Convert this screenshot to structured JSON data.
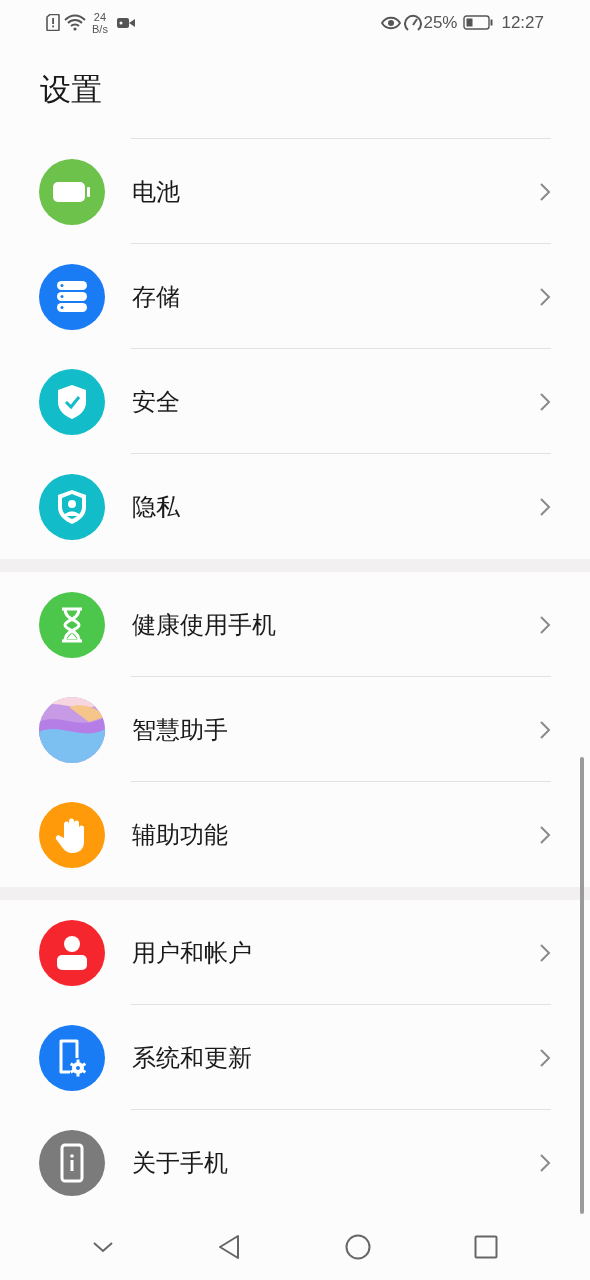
{
  "status_bar": {
    "speed_value": "24",
    "speed_unit": "B/s",
    "battery": "25%",
    "time": "12:27"
  },
  "title": "设置",
  "groups": [
    {
      "items": [
        {
          "label": "电池",
          "kind": "battery",
          "color": "#6cc24a"
        },
        {
          "label": "存储",
          "kind": "storage",
          "color": "#1a7cf5"
        },
        {
          "label": "安全",
          "kind": "security",
          "color": "#12bcc8"
        },
        {
          "label": "隐私",
          "kind": "privacy",
          "color": "#12bcc8"
        }
      ]
    },
    {
      "items": [
        {
          "label": "健康使用手机",
          "kind": "hourglass",
          "color": "#4cc74c"
        },
        {
          "label": "智慧助手",
          "kind": "assistant",
          "color": "#c79ae6"
        },
        {
          "label": "辅助功能",
          "kind": "hand",
          "color": "#ff9b0a"
        }
      ]
    },
    {
      "items": [
        {
          "label": "用户和帐户",
          "kind": "user",
          "color": "#f5262e"
        },
        {
          "label": "系统和更新",
          "kind": "system",
          "color": "#1a7cf5"
        },
        {
          "label": "关于手机",
          "kind": "about",
          "color": "#7b7b7b"
        }
      ]
    }
  ]
}
